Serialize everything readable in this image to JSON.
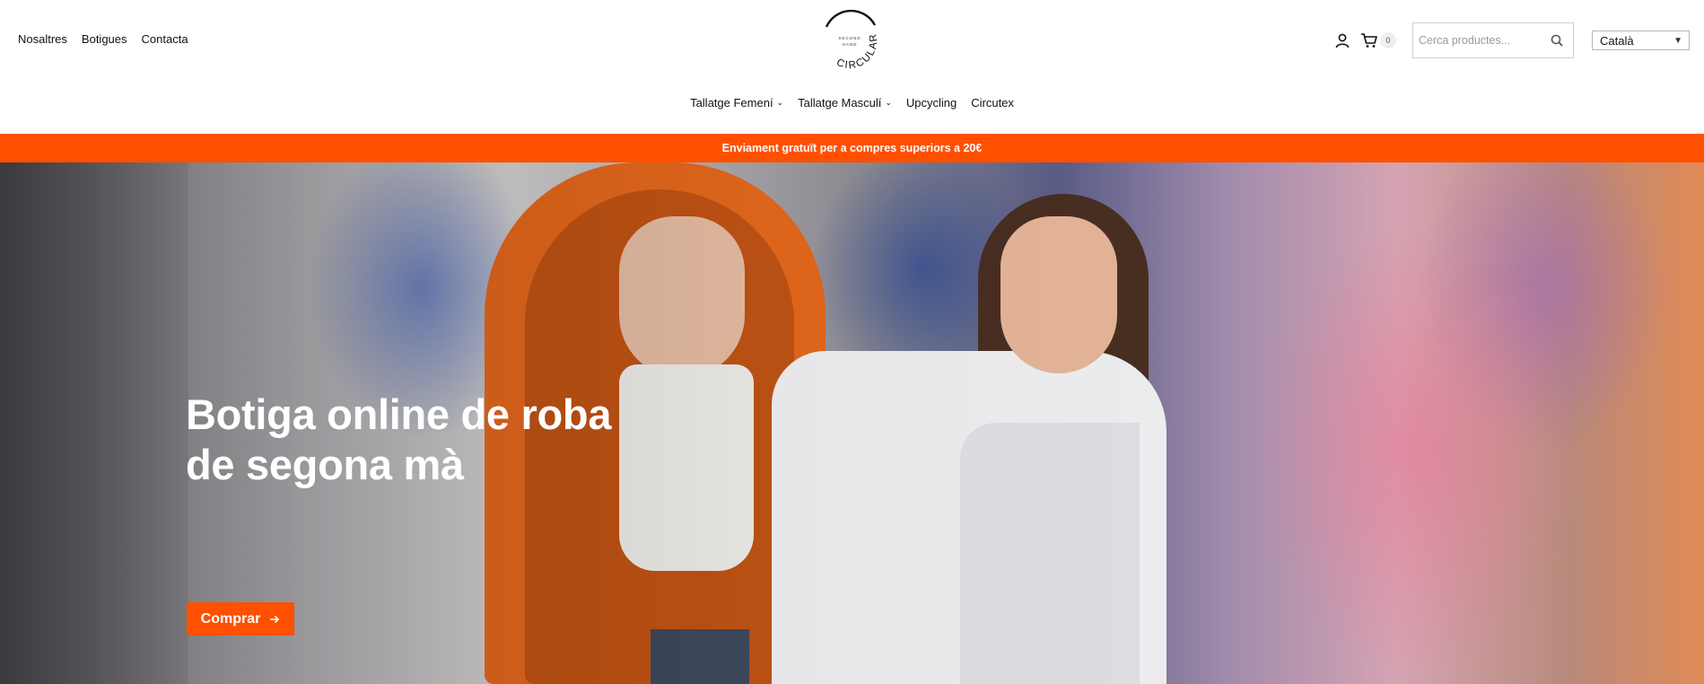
{
  "header": {
    "top_nav": [
      "Nosaltres",
      "Botigues",
      "Contacta"
    ],
    "logo": {
      "top_text": "SECOND",
      "mid_text": "HAND",
      "ring_text": "CIRCULAR"
    },
    "cart_count": "0",
    "search": {
      "placeholder": "Cerca productes..."
    },
    "language": {
      "selected": "Català"
    },
    "main_nav": [
      {
        "label": "Tallatge Femení",
        "has_dropdown": true
      },
      {
        "label": "Tallatge Masculí",
        "has_dropdown": true
      },
      {
        "label": "Upcycling",
        "has_dropdown": false
      },
      {
        "label": "Circutex",
        "has_dropdown": false
      }
    ],
    "icons": [
      "user-icon",
      "cart-icon",
      "search-icon",
      "chevron-down-icon"
    ]
  },
  "promo_bar": {
    "text": "Enviament gratuït per a compres superiors a 20€",
    "color": "#ff5000"
  },
  "hero": {
    "title_line1": "Botiga online de roba",
    "title_line2": "de segona mà",
    "cta_label": "Comprar",
    "cta_color": "#ff5000"
  }
}
